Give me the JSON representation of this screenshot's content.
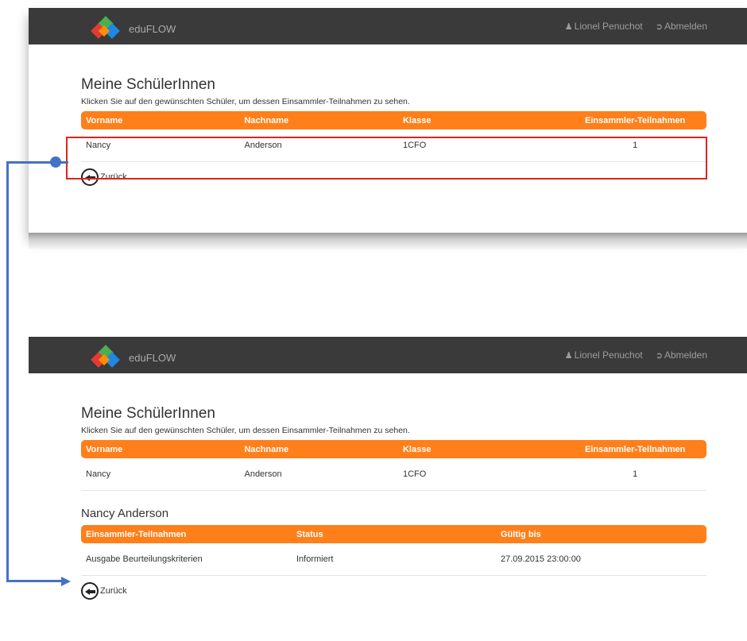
{
  "app": {
    "brand": "eduFLOW",
    "user": "Lionel Penuchot",
    "logout": "Abmelden"
  },
  "page": {
    "title": "Meine SchülerInnen",
    "hint": "Klicken Sie auf den gewünschten Schüler, um dessen Einsammler-Teilnahmen zu sehen.",
    "back_label": "Zurück"
  },
  "students_table": {
    "headers": [
      "Vorname",
      "Nachname",
      "Klasse",
      "Einsammler-Teilnahmen"
    ],
    "rows": [
      {
        "first": "Nancy",
        "last": "Anderson",
        "class": "1CFO",
        "count": "1"
      }
    ]
  },
  "detail": {
    "name": "Nancy Anderson",
    "headers": [
      "Einsammler-Teilnahmen",
      "Status",
      "Gültig bis"
    ],
    "rows": [
      {
        "title": "Ausgabe Beurteilungskriterien",
        "status": "Informiert",
        "valid_until": "27.09.2015 23:00:00"
      }
    ]
  },
  "colors": {
    "accent": "#ff7f1a",
    "navbar": "#3a3a3a",
    "highlight": "#e2231a",
    "connector": "#4472c4"
  }
}
